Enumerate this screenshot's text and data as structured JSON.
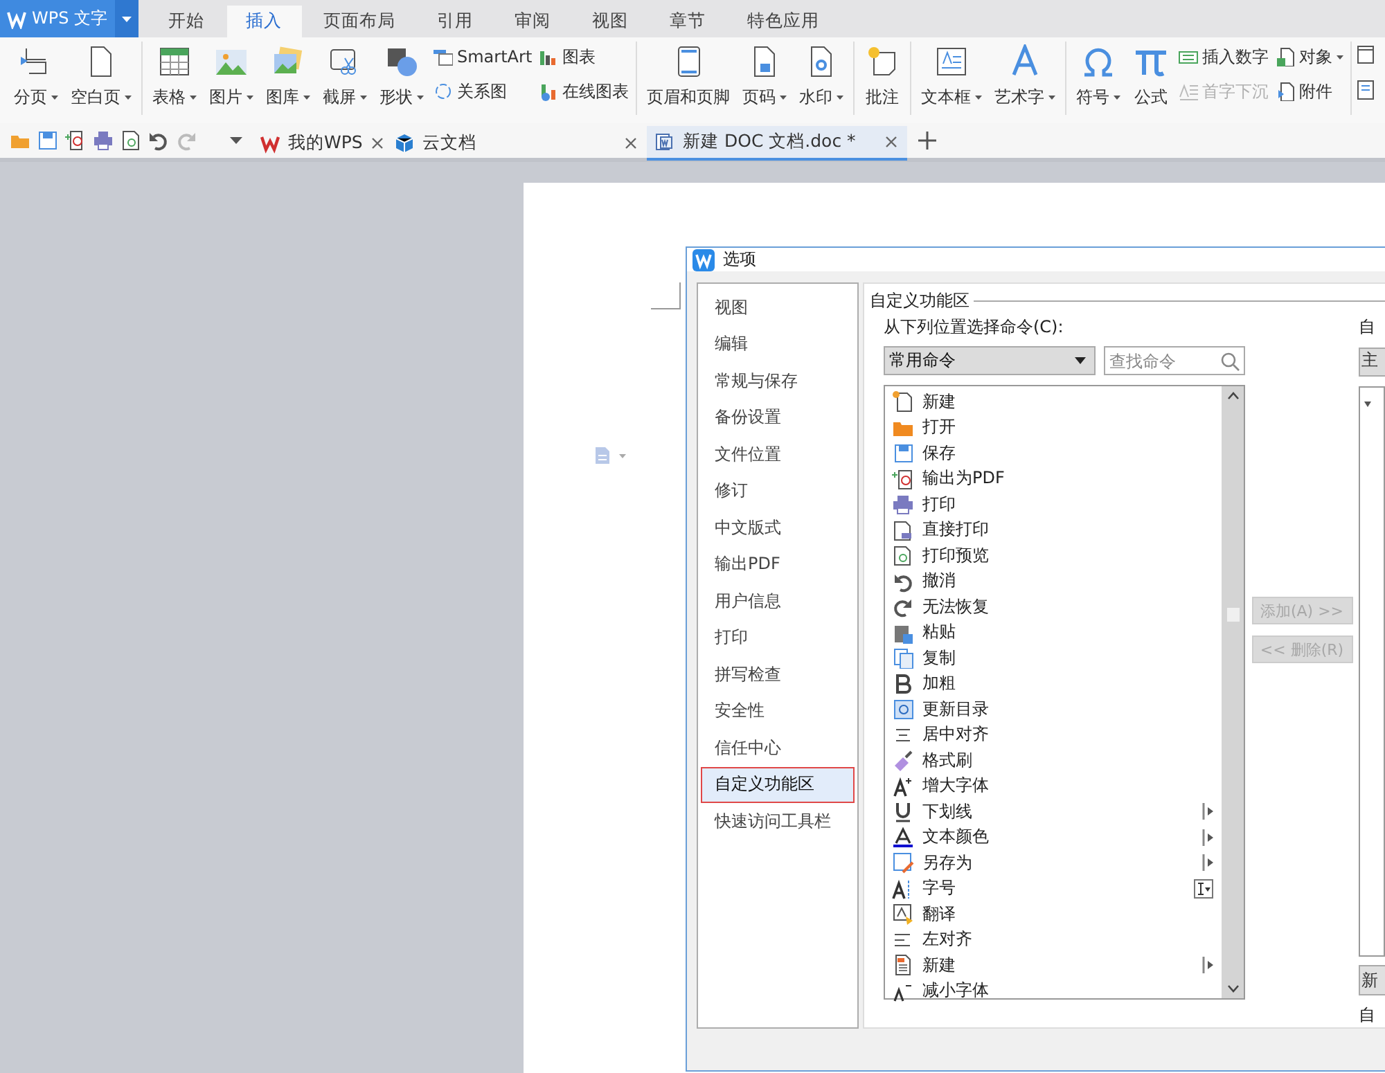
{
  "app_menu": {
    "label": "WPS 文字"
  },
  "tabs": [
    {
      "label": "开始",
      "selected": false
    },
    {
      "label": "插入",
      "selected": true
    },
    {
      "label": "页面布局",
      "selected": false
    },
    {
      "label": "引用",
      "selected": false
    },
    {
      "label": "审阅",
      "selected": false
    },
    {
      "label": "视图",
      "selected": false
    },
    {
      "label": "章节",
      "selected": false
    },
    {
      "label": "特色应用",
      "selected": false
    }
  ],
  "ribbon": {
    "groups": [
      {
        "items": [
          {
            "kind": "large",
            "label": "分页",
            "dropdown": true
          },
          {
            "kind": "large",
            "label": "空白页",
            "dropdown": true
          }
        ]
      },
      {
        "items": [
          {
            "kind": "large",
            "label": "表格",
            "dropdown": true
          },
          {
            "kind": "large",
            "label": "图片",
            "dropdown": true
          },
          {
            "kind": "large",
            "label": "图库",
            "dropdown": true
          },
          {
            "kind": "large",
            "label": "截屏",
            "dropdown": true
          },
          {
            "kind": "large",
            "label": "形状",
            "dropdown": true
          },
          {
            "kind": "stack",
            "items": [
              {
                "label": "SmartArt",
                "dropdown": false,
                "disabled": false
              },
              {
                "label": "关系图",
                "dropdown": false,
                "disabled": false
              }
            ]
          },
          {
            "kind": "stack",
            "items": [
              {
                "label": "图表",
                "dropdown": false,
                "disabled": false
              },
              {
                "label": "在线图表",
                "dropdown": false,
                "disabled": false
              }
            ]
          }
        ]
      },
      {
        "items": [
          {
            "kind": "large",
            "label": "页眉和页脚",
            "dropdown": false
          },
          {
            "kind": "large",
            "label": "页码",
            "dropdown": true
          },
          {
            "kind": "large",
            "label": "水印",
            "dropdown": true
          }
        ]
      },
      {
        "items": [
          {
            "kind": "large",
            "label": "批注",
            "dropdown": false
          }
        ]
      },
      {
        "items": [
          {
            "kind": "large",
            "label": "文本框",
            "dropdown": true
          },
          {
            "kind": "large",
            "label": "艺术字",
            "dropdown": true
          }
        ]
      },
      {
        "items": [
          {
            "kind": "large",
            "label": "符号",
            "dropdown": true
          },
          {
            "kind": "large",
            "label": "公式",
            "dropdown": false
          },
          {
            "kind": "stack",
            "items": [
              {
                "label": "插入数字",
                "dropdown": false,
                "disabled": false
              },
              {
                "label": "首字下沉",
                "dropdown": false,
                "disabled": true
              }
            ]
          },
          {
            "kind": "stack",
            "items": [
              {
                "label": "对象",
                "dropdown": true,
                "disabled": false
              },
              {
                "label": "附件",
                "dropdown": false,
                "disabled": false
              }
            ]
          }
        ]
      }
    ]
  },
  "doc_tabs": [
    {
      "label": "我的WPS",
      "selected": false
    },
    {
      "label": "云文档",
      "selected": false
    },
    {
      "label": "新建 DOC 文档.doc *",
      "selected": true
    }
  ],
  "dialog": {
    "title": "选项",
    "nav": [
      {
        "label": "视图",
        "selected": false,
        "highlighted": false
      },
      {
        "label": "编辑",
        "selected": false,
        "highlighted": false
      },
      {
        "label": "常规与保存",
        "selected": false,
        "highlighted": false
      },
      {
        "label": "备份设置",
        "selected": false,
        "highlighted": false
      },
      {
        "label": "文件位置",
        "selected": false,
        "highlighted": false
      },
      {
        "label": "修订",
        "selected": false,
        "highlighted": false
      },
      {
        "label": "中文版式",
        "selected": false,
        "highlighted": false
      },
      {
        "label": "输出PDF",
        "selected": false,
        "highlighted": false
      },
      {
        "label": "用户信息",
        "selected": false,
        "highlighted": false
      },
      {
        "label": "打印",
        "selected": false,
        "highlighted": false
      },
      {
        "label": "拼写检查",
        "selected": false,
        "highlighted": false
      },
      {
        "label": "安全性",
        "selected": false,
        "highlighted": false
      },
      {
        "label": "信任中心",
        "selected": false,
        "highlighted": false
      },
      {
        "label": "自定义功能区",
        "selected": true,
        "highlighted": true
      },
      {
        "label": "快速访问工具栏",
        "selected": false,
        "highlighted": false
      }
    ],
    "section_title": "自定义功能区",
    "source_label": "从下列位置选择命令(C):",
    "source_value": "常用命令",
    "search": {
      "placeholder": "查找命令"
    },
    "commands": [
      {
        "label": "新建",
        "kind": "plain"
      },
      {
        "label": "打开",
        "kind": "plain"
      },
      {
        "label": "保存",
        "kind": "plain"
      },
      {
        "label": "输出为PDF",
        "kind": "plain"
      },
      {
        "label": "打印",
        "kind": "plain"
      },
      {
        "label": "直接打印",
        "kind": "plain"
      },
      {
        "label": "打印预览",
        "kind": "plain"
      },
      {
        "label": "撤消",
        "kind": "plain"
      },
      {
        "label": "无法恢复",
        "kind": "plain"
      },
      {
        "label": "粘贴",
        "kind": "plain"
      },
      {
        "label": "复制",
        "kind": "plain"
      },
      {
        "label": "加粗",
        "kind": "plain"
      },
      {
        "label": "更新目录",
        "kind": "plain"
      },
      {
        "label": "居中对齐",
        "kind": "plain"
      },
      {
        "label": "格式刷",
        "kind": "plain"
      },
      {
        "label": "增大字体",
        "kind": "plain"
      },
      {
        "label": "下划线",
        "kind": "submenu"
      },
      {
        "label": "文本颜色",
        "kind": "submenu"
      },
      {
        "label": "另存为",
        "kind": "submenu"
      },
      {
        "label": "字号",
        "kind": "combo"
      },
      {
        "label": "翻译",
        "kind": "plain"
      },
      {
        "label": "左对齐",
        "kind": "plain"
      },
      {
        "label": "新建",
        "kind": "submenu"
      },
      {
        "label": "减小字体",
        "kind": "plain"
      }
    ],
    "add_button": {
      "label": "添加(A) >>",
      "disabled": true
    },
    "remove_button": {
      "label": "<< 删除(R)",
      "disabled": true
    },
    "right_label": "自",
    "right_dropdown": "主",
    "right_button": "新",
    "right_footer": "自"
  }
}
